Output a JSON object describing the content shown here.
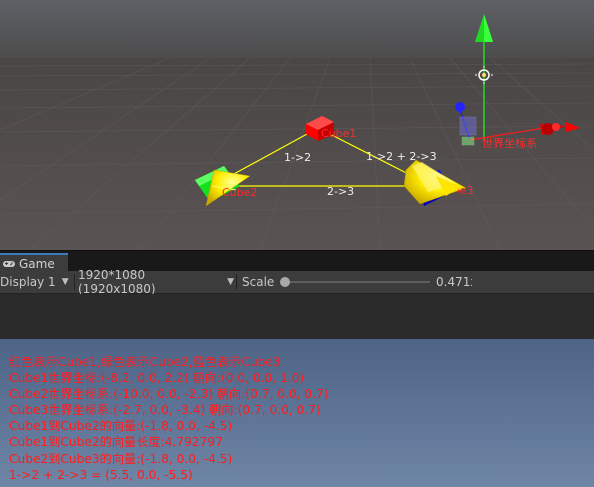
{
  "scene": {
    "labels": {
      "cube1": "Cube1",
      "cube2": "Cube2",
      "cube3": "Cube3",
      "edge12": "1->2",
      "edge23": "2->3",
      "edge_sum": "1->2 + 2->3",
      "world_axes": "世界坐标系"
    },
    "colors": {
      "cube1": "#ff0000",
      "cube2": "#00e000",
      "cube3": "#0000ff",
      "vector_lines": "#ffff00",
      "label_text": "#ffffff",
      "label_red": "#ff2a2a",
      "gizmo_x": "#ff1a1a",
      "gizmo_y": "#1aff1a",
      "gizmo_z": "#1a1aff"
    }
  },
  "game_tab": {
    "icon": "gamepad-icon",
    "label": "Game"
  },
  "toolbar": {
    "display": "Display 1",
    "resolution": "1920*1080 (1920x1080)",
    "scale_label": "Scale",
    "scale_value": "0.471x"
  },
  "game_view": {
    "text_color": "#ff1c1c",
    "lines": [
      "红色表示Cube1,绿色表示Cube2,蓝色表示Cube3",
      "Cube1世界坐标:(-8.2, 0.0, 2.2) 朝向:(0.0, 0.0, 1.0)",
      "Cube2世界坐标系:(-10.0, 0.0, -2.3) 朝向:(0.7, 0.0, 0.7)",
      "Cube3世界坐标系:(-2.7, 0.0, -3.4) 朝向:(0.7, 0.0, 0.7)",
      "Cube1到Cube2的向量:(-1.8, 0.0, -4.5)",
      "Cube1到Cube2的向量长度:4.792797",
      "Cube2到Cube3的向量:(-1.8, 0.0, -4.5)",
      "1->2 + 2->3 = (5.5, 0.0, -5.5)"
    ]
  }
}
